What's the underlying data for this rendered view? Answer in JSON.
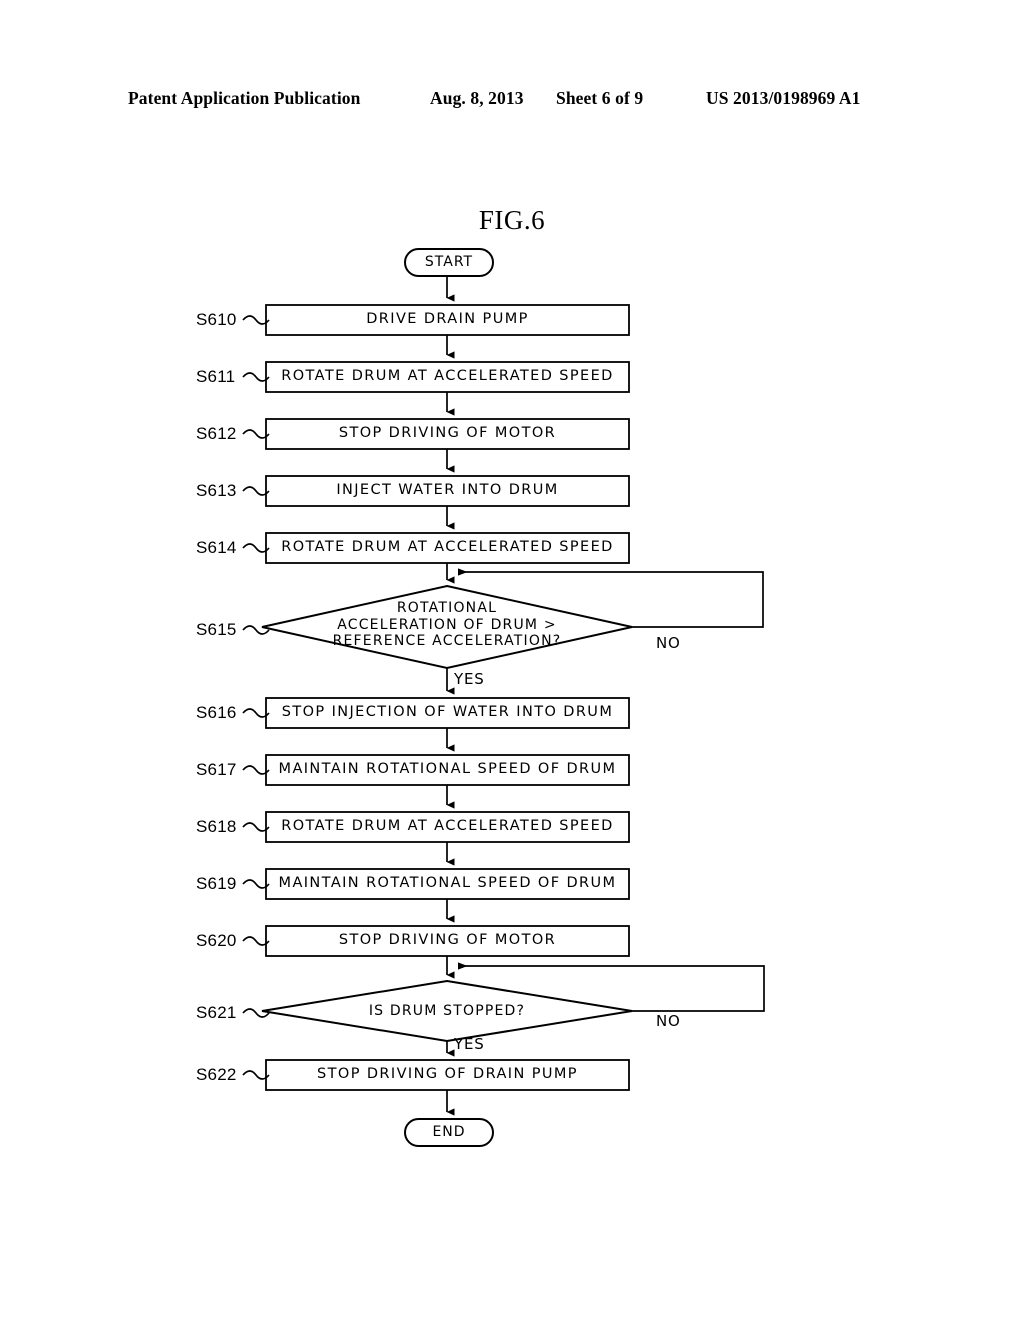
{
  "header": {
    "publication": "Patent Application Publication",
    "date": "Aug. 8, 2013",
    "sheet": "Sheet 6 of 9",
    "patent_number": "US 2013/0198969 A1"
  },
  "figure": {
    "title": "FIG.6",
    "start_label": "START",
    "end_label": "END",
    "yes_label": "YES",
    "no_label": "NO",
    "line_color": "#000000",
    "background": "#ffffff"
  },
  "steps": [
    {
      "ref": "S610",
      "text": "DRIVE DRAIN PUMP",
      "type": "process"
    },
    {
      "ref": "S611",
      "text": "ROTATE DRUM AT ACCELERATED SPEED",
      "type": "process"
    },
    {
      "ref": "S612",
      "text": "STOP DRIVING OF MOTOR",
      "type": "process"
    },
    {
      "ref": "S613",
      "text": "INJECT WATER INTO DRUM",
      "type": "process"
    },
    {
      "ref": "S614",
      "text": "ROTATE DRUM AT ACCELERATED SPEED",
      "type": "process"
    },
    {
      "ref": "S615",
      "text": "ROTATIONAL ACCELERATION OF DRUM > REFERENCE ACCELERATION?",
      "type": "decision",
      "line1": "ROTATIONAL",
      "line2": "ACCELERATION OF DRUM >",
      "line3": "REFERENCE ACCELERATION?"
    },
    {
      "ref": "S616",
      "text": "STOP INJECTION OF WATER INTO DRUM",
      "type": "process"
    },
    {
      "ref": "S617",
      "text": "MAINTAIN ROTATIONAL SPEED OF DRUM",
      "type": "process"
    },
    {
      "ref": "S618",
      "text": "ROTATE DRUM AT ACCELERATED SPEED",
      "type": "process"
    },
    {
      "ref": "S619",
      "text": "MAINTAIN ROTATIONAL SPEED OF DRUM",
      "type": "process"
    },
    {
      "ref": "S620",
      "text": "STOP DRIVING OF MOTOR",
      "type": "process"
    },
    {
      "ref": "S621",
      "text": "IS DRUM STOPPED?",
      "type": "decision",
      "line1": "IS DRUM STOPPED?"
    },
    {
      "ref": "S622",
      "text": "STOP DRIVING OF DRAIN PUMP",
      "type": "process"
    }
  ]
}
